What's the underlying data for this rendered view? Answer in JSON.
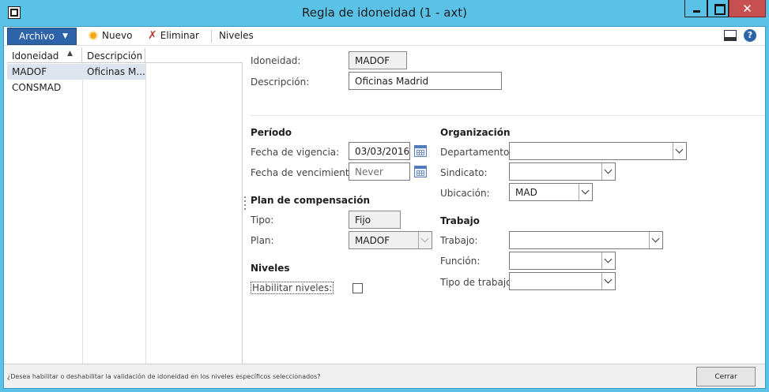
{
  "window": {
    "title": "Regla de idoneidad (1 - axt)",
    "close_glyph": "✕"
  },
  "actionpane": {
    "archivo_label": "Archivo",
    "nuevo_label": "Nuevo",
    "eliminar_label": "Eliminar",
    "niveles_label": "Niveles",
    "help_glyph": "?"
  },
  "grid": {
    "columns": [
      "Idoneidad",
      "Descripción"
    ],
    "rows": [
      {
        "idoneidad": "MADOF",
        "descripcion": "Oficinas M...",
        "selected": true
      },
      {
        "idoneidad": "CONSMAD",
        "descripcion": "",
        "selected": false
      }
    ]
  },
  "form": {
    "idoneidad": {
      "label": "Idoneidad:",
      "value": "MADOF"
    },
    "descripcion": {
      "label": "Descripción:",
      "value": "Oficinas Madrid"
    },
    "periodo": {
      "title": "Período",
      "vigencia": {
        "label": "Fecha de vigencia:",
        "value": "03/03/2016"
      },
      "vencimiento": {
        "label": "Fecha de vencimiento:",
        "value": "Never"
      }
    },
    "plan_compensacion": {
      "title": "Plan de compensación",
      "tipo": {
        "label": "Tipo:",
        "value": "Fijo"
      },
      "plan": {
        "label": "Plan:",
        "value": "MADOF"
      }
    },
    "niveles": {
      "title": "Niveles",
      "habilitar": {
        "label": "Habilitar niveles:",
        "checked": false
      }
    },
    "organizacion": {
      "title": "Organización",
      "departamento": {
        "label": "Departamento:",
        "value": ""
      },
      "sindicato": {
        "label": "Sindicato:",
        "value": ""
      },
      "ubicacion": {
        "label": "Ubicación:",
        "value": "MAD"
      }
    },
    "trabajo": {
      "title": "Trabajo",
      "trabajo": {
        "label": "Trabajo:",
        "value": ""
      },
      "funcion": {
        "label": "Función:",
        "value": ""
      },
      "tipo_trabajo": {
        "label": "Tipo de trabajo:",
        "value": ""
      }
    }
  },
  "statusbar": {
    "help_text": "¿Desea habilitar o deshabilitar la validación de idoneidad en los niveles específicos seleccionados?",
    "close_label": "Cerrar"
  },
  "colors": {
    "window_frame": "#5bc2e7",
    "archivo_button": "#2d63a8",
    "close_button": "#c75050",
    "selected_row": "#dde4ed"
  }
}
